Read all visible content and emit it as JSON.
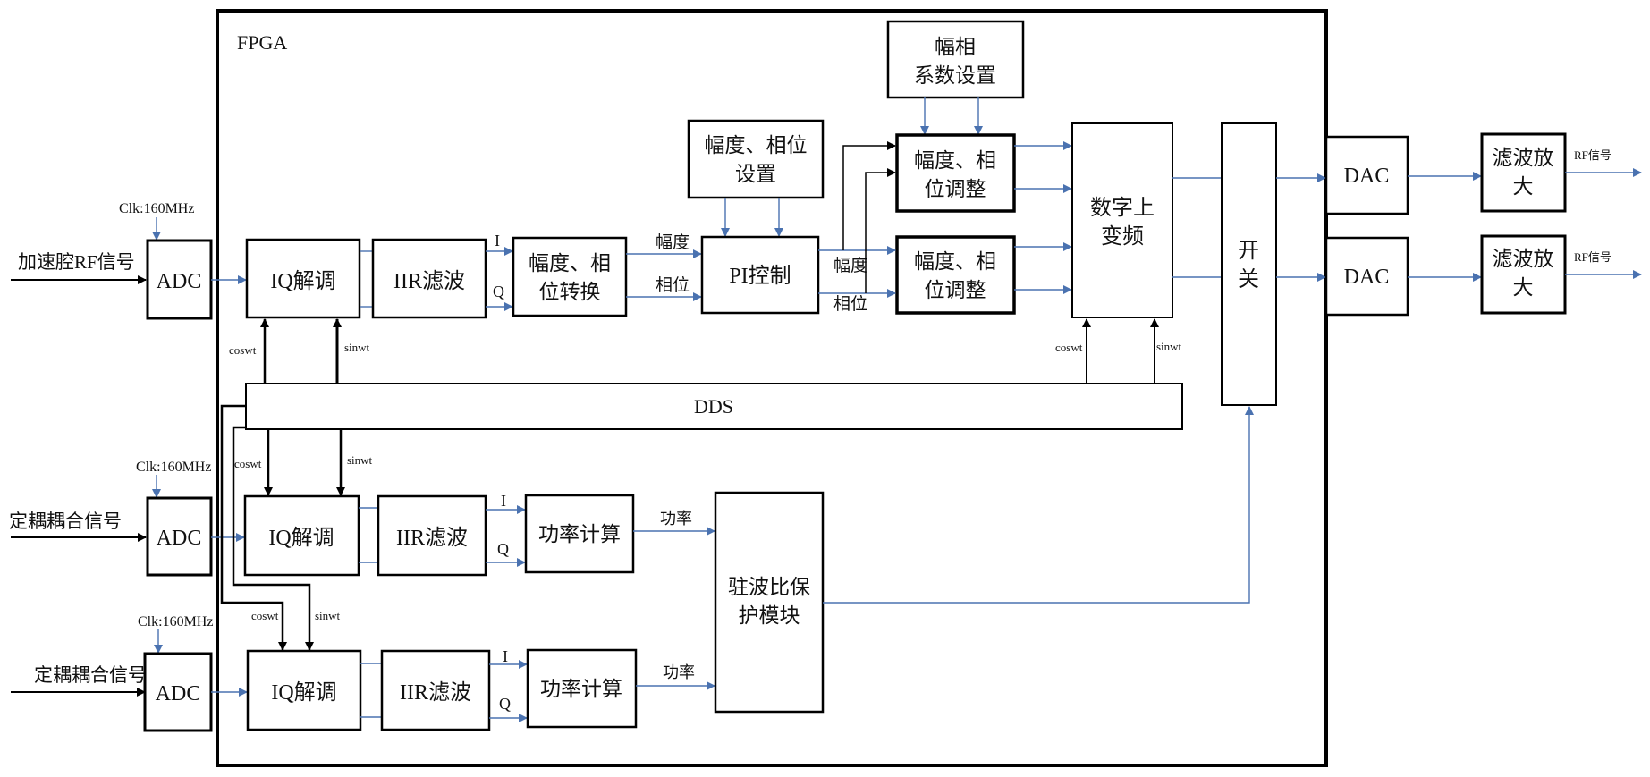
{
  "fpga_label": "FPGA",
  "inputs": {
    "rf_in": "加速腔RF信号",
    "coupler1": "定耦耦合信号",
    "coupler2": "定耦耦合信号",
    "clk": "Clk:160MHz"
  },
  "blocks": {
    "adc": "ADC",
    "iq_demod": "IQ解调",
    "iir": "IIR滤波",
    "amp_phase_conv_1": "幅度、相",
    "amp_phase_conv_2": "位转换",
    "amp_phase_set_1": "幅度、相位",
    "amp_phase_set_2": "设置",
    "pi": "PI控制",
    "coef_set_1": "幅相",
    "coef_set_2": "系数设置",
    "adjust_1": "幅度、相",
    "adjust_2": "位调整",
    "duc_1": "数字上",
    "duc_2": "变频",
    "switch_1": "开",
    "switch_2": "关",
    "dac": "DAC",
    "filter_amp_1": "滤波放",
    "filter_amp_2": "大",
    "dds": "DDS",
    "power_calc": "功率计算",
    "vswr_1": "驻波比保",
    "vswr_2": "护模块"
  },
  "signals": {
    "i": "I",
    "q": "Q",
    "amplitude": "幅度",
    "phase": "相位",
    "coswt": "coswt",
    "sinwt": "sinwt",
    "power": "功率",
    "rf_out": "RF信号"
  },
  "colors": {
    "signal_line": "#4a72b0",
    "control_line": "#000000"
  }
}
